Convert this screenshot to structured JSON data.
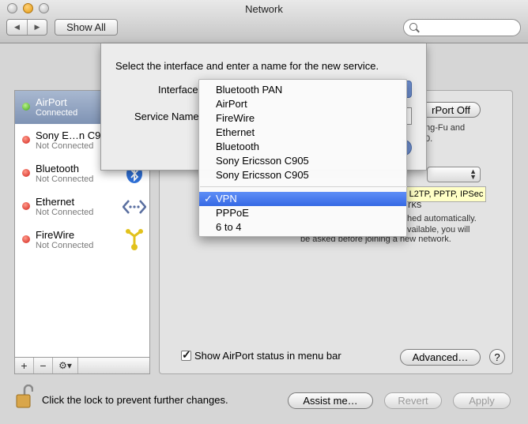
{
  "window": {
    "title": "Network",
    "show_all_label": "Show All"
  },
  "sidebar": {
    "items": [
      {
        "name": "AirPort",
        "status": "Connected",
        "selected": true,
        "dot": "green"
      },
      {
        "name": "Sony E…n C9",
        "status": "Not Connected",
        "dot": "red"
      },
      {
        "name": "Bluetooth",
        "status": "Not Connected",
        "dot": "red"
      },
      {
        "name": "Ethernet",
        "status": "Not Connected",
        "dot": "red"
      },
      {
        "name": "FireWire",
        "status": "Not Connected",
        "dot": "red"
      }
    ],
    "buttons": {
      "add": "+",
      "remove": "−",
      "gear": "⚙▾"
    }
  },
  "main": {
    "airport_off_label": "rPort Off",
    "snippets": [
      "ng-Fu and",
      "0.",
      "rks",
      "hed automatically.",
      "vailable, you will",
      "be asked before joining a new network."
    ],
    "tooltip": "L2TP, PPTP, IPSec",
    "show_status_label": "Show AirPort status in menu bar",
    "advanced_label": "Advanced…",
    "help_label": "?"
  },
  "sheet": {
    "message": "Select the interface and enter a name for the new service.",
    "interface_label": "Interface",
    "service_name_label": "Service Name"
  },
  "menu": {
    "group1": [
      "Bluetooth PAN",
      "AirPort",
      "FireWire",
      "Ethernet",
      "Bluetooth",
      "Sony Ericsson C905",
      "Sony Ericsson C905"
    ],
    "selected": "VPN",
    "check_glyph": "✓",
    "group2": [
      "PPPoE",
      "6 to 4"
    ]
  },
  "footer": {
    "lock_text": "Click the lock to prevent further changes.",
    "assist_label": "Assist me…",
    "revert_label": "Revert",
    "apply_label": "Apply"
  },
  "colors": {
    "selection": "#3569e4",
    "connected": "#3ea313",
    "not_connected": "#d1221b",
    "tooltip": "#ffffc6"
  }
}
